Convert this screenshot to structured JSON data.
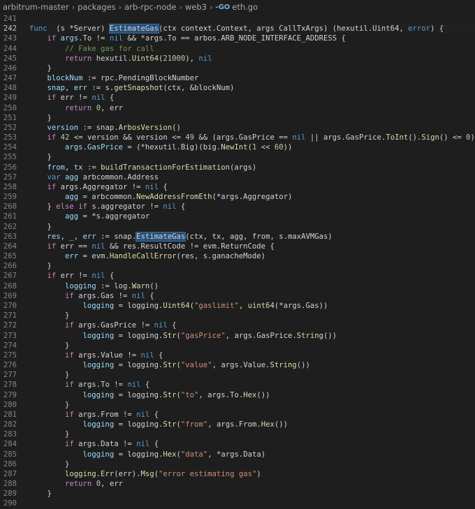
{
  "breadcrumb": [
    "arbitrum-master",
    "packages",
    "arb-rpc-node",
    "web3",
    "eth.go"
  ],
  "file_icon": "go-file-icon",
  "current_line": 242,
  "lines": [
    {
      "n": "241",
      "s": []
    },
    {
      "n": "242",
      "s": [
        [
          "kw",
          "func"
        ],
        [
          "",
          "  (s *Server) "
        ],
        [
          "hl",
          "EstimateGas"
        ],
        [
          "",
          "(ctx context.Context, args CallTxArgs) (hexutil.Uint64, "
        ],
        [
          "kw",
          "error"
        ],
        [
          "",
          ") {"
        ]
      ]
    },
    {
      "n": "243",
      "s": [
        [
          "",
          "    "
        ],
        [
          "kw2",
          "if"
        ],
        [
          "var",
          " args"
        ],
        [
          "",
          ".To != "
        ],
        [
          "kw",
          "nil"
        ],
        [
          "",
          ""
        ],
        [
          "",
          ""
        ],
        [
          "",
          ""
        ],
        [
          "",
          " && *args.To == arbos.ARB_NODE_INTERFACE_ADDRESS {"
        ]
      ]
    },
    {
      "n": "244",
      "s": [
        [
          "",
          "        "
        ],
        [
          "com",
          "// Fake gas for call"
        ]
      ]
    },
    {
      "n": "245",
      "s": [
        [
          "",
          "        "
        ],
        [
          "kw2",
          "return"
        ],
        [
          "",
          " hexutil."
        ],
        [
          "fn",
          "Uint64"
        ],
        [
          "",
          "("
        ],
        [
          "num",
          "21000"
        ],
        [
          "",
          "), "
        ],
        [
          "kw",
          "nil"
        ]
      ]
    },
    {
      "n": "246",
      "s": [
        [
          "",
          "    }"
        ]
      ]
    },
    {
      "n": "247",
      "s": [
        [
          "",
          "    "
        ],
        [
          "var",
          "blockNum"
        ],
        [
          "",
          " := rpc.PendingBlockNumber"
        ]
      ]
    },
    {
      "n": "248",
      "s": [
        [
          "",
          "    "
        ],
        [
          "var",
          "snap"
        ],
        [
          "",
          ", "
        ],
        [
          "var",
          "err"
        ],
        [
          "",
          " := s."
        ],
        [
          "fn",
          "getSnapshot"
        ],
        [
          "",
          "(ctx, &blockNum)"
        ]
      ]
    },
    {
      "n": "249",
      "s": [
        [
          "",
          "    "
        ],
        [
          "kw2",
          "if"
        ],
        [
          "",
          " err != "
        ],
        [
          "kw",
          "nil"
        ],
        [
          "",
          " {"
        ]
      ]
    },
    {
      "n": "250",
      "s": [
        [
          "",
          "        "
        ],
        [
          "kw2",
          "return"
        ],
        [
          "",
          " "
        ],
        [
          "num",
          "0"
        ],
        [
          "",
          ", err"
        ]
      ]
    },
    {
      "n": "251",
      "s": [
        [
          "",
          "    }"
        ]
      ]
    },
    {
      "n": "252",
      "s": [
        [
          "",
          "    "
        ],
        [
          "var",
          "version"
        ],
        [
          "",
          " := snap."
        ],
        [
          "fn",
          "ArbosVersion"
        ],
        [
          "",
          "()"
        ]
      ]
    },
    {
      "n": "253",
      "s": [
        [
          "",
          "    "
        ],
        [
          "kw2",
          "if"
        ],
        [
          "",
          " "
        ],
        [
          "num",
          "42"
        ],
        [
          "",
          " <= version && version <= "
        ],
        [
          "num",
          "49"
        ],
        [
          "",
          " && (args.GasPrice == "
        ],
        [
          "kw",
          "nil"
        ],
        [
          "",
          " || args.GasPrice."
        ],
        [
          "fn",
          "ToInt"
        ],
        [
          "",
          "()."
        ],
        [
          "fn",
          "Sign"
        ],
        [
          "",
          "() <= "
        ],
        [
          "num",
          "0"
        ],
        [
          "",
          ") {"
        ]
      ]
    },
    {
      "n": "254",
      "s": [
        [
          "",
          "        "
        ],
        [
          "var",
          "args"
        ],
        [
          "",
          "."
        ],
        [
          "var",
          "GasPrice"
        ],
        [
          "",
          " = (*hexutil.Big)(big."
        ],
        [
          "fn",
          "NewInt"
        ],
        [
          "",
          "("
        ],
        [
          "num",
          "1"
        ],
        [
          "",
          " << "
        ],
        [
          "num",
          "60"
        ],
        [
          "",
          "))"
        ]
      ]
    },
    {
      "n": "255",
      "s": [
        [
          "",
          "    }"
        ]
      ]
    },
    {
      "n": "256",
      "s": [
        [
          "",
          "    "
        ],
        [
          "var",
          "from"
        ],
        [
          "",
          ", "
        ],
        [
          "var",
          "tx"
        ],
        [
          "",
          " := "
        ],
        [
          "fn",
          "buildTransactionForEstimation"
        ],
        [
          "",
          "(args)"
        ]
      ]
    },
    {
      "n": "257",
      "s": [
        [
          "",
          "    "
        ],
        [
          "kw",
          "var"
        ],
        [
          "",
          " "
        ],
        [
          "var",
          "agg"
        ],
        [
          "",
          " arbcommon.Address"
        ]
      ]
    },
    {
      "n": "258",
      "s": [
        [
          "",
          "    "
        ],
        [
          "kw2",
          "if"
        ],
        [
          "",
          " args.Aggregator != "
        ],
        [
          "kw",
          "nil"
        ],
        [
          "",
          " {"
        ]
      ]
    },
    {
      "n": "259",
      "s": [
        [
          "",
          "        "
        ],
        [
          "var",
          "agg"
        ],
        [
          "",
          " = arbcommon."
        ],
        [
          "fn",
          "NewAddressFromEth"
        ],
        [
          "",
          "(*args.Aggregator)"
        ]
      ]
    },
    {
      "n": "260",
      "s": [
        [
          "",
          "    } "
        ],
        [
          "kw2",
          "else if"
        ],
        [
          "",
          " s.aggregator != "
        ],
        [
          "kw",
          "nil"
        ],
        [
          "",
          " {"
        ]
      ]
    },
    {
      "n": "261",
      "s": [
        [
          "",
          "        "
        ],
        [
          "var",
          "agg"
        ],
        [
          "",
          " = *s.aggregator"
        ]
      ]
    },
    {
      "n": "262",
      "s": [
        [
          "",
          "    }"
        ]
      ]
    },
    {
      "n": "263",
      "s": [
        [
          "",
          "    "
        ],
        [
          "var",
          "res"
        ],
        [
          "",
          ", _, "
        ],
        [
          "var",
          "err"
        ],
        [
          "",
          " := snap."
        ],
        [
          "hl",
          "EstimateGas"
        ],
        [
          "",
          "(ctx, tx, agg, from, s.maxAVMGas)"
        ]
      ]
    },
    {
      "n": "264",
      "s": [
        [
          "",
          "    "
        ],
        [
          "kw2",
          "if"
        ],
        [
          "",
          " err == "
        ],
        [
          "kw",
          "nil"
        ],
        [
          "",
          " && res.ResultCode != evm.ReturnCode {"
        ]
      ]
    },
    {
      "n": "265",
      "s": [
        [
          "",
          "        "
        ],
        [
          "var",
          "err"
        ],
        [
          "",
          " = evm."
        ],
        [
          "fn",
          "HandleCallError"
        ],
        [
          "",
          "(res, s.ganacheMode)"
        ]
      ]
    },
    {
      "n": "266",
      "s": [
        [
          "",
          "    }"
        ]
      ]
    },
    {
      "n": "267",
      "s": [
        [
          "",
          "    "
        ],
        [
          "kw2",
          "if"
        ],
        [
          "",
          " err != "
        ],
        [
          "kw",
          "nil"
        ],
        [
          "",
          " {"
        ]
      ]
    },
    {
      "n": "268",
      "s": [
        [
          "",
          "        "
        ],
        [
          "var",
          "logging"
        ],
        [
          "",
          " := log."
        ],
        [
          "fn",
          "Warn"
        ],
        [
          "",
          "()"
        ]
      ]
    },
    {
      "n": "269",
      "s": [
        [
          "",
          "        "
        ],
        [
          "kw2",
          "if"
        ],
        [
          "",
          " args.Gas != "
        ],
        [
          "kw",
          "nil"
        ],
        [
          "",
          " {"
        ]
      ]
    },
    {
      "n": "270",
      "s": [
        [
          "",
          "            "
        ],
        [
          "var",
          "logging"
        ],
        [
          "",
          " = logging."
        ],
        [
          "fn",
          "Uint64"
        ],
        [
          "",
          "("
        ],
        [
          "str",
          "\"gaslimit\""
        ],
        [
          "",
          ", "
        ],
        [
          "fn",
          "uint64"
        ],
        [
          "",
          "(*args.Gas))"
        ]
      ]
    },
    {
      "n": "271",
      "s": [
        [
          "",
          "        }"
        ]
      ]
    },
    {
      "n": "272",
      "s": [
        [
          "",
          "        "
        ],
        [
          "kw2",
          "if"
        ],
        [
          "",
          " args.GasPrice != "
        ],
        [
          "kw",
          "nil"
        ],
        [
          "",
          " {"
        ]
      ]
    },
    {
      "n": "273",
      "s": [
        [
          "",
          "            "
        ],
        [
          "var",
          "logging"
        ],
        [
          "",
          " = logging."
        ],
        [
          "fn",
          "Str"
        ],
        [
          "",
          "("
        ],
        [
          "str",
          "\"gasPrice\""
        ],
        [
          "",
          ", args.GasPrice."
        ],
        [
          "fn",
          "String"
        ],
        [
          "",
          "())"
        ]
      ]
    },
    {
      "n": "274",
      "s": [
        [
          "",
          "        }"
        ]
      ]
    },
    {
      "n": "275",
      "s": [
        [
          "",
          "        "
        ],
        [
          "kw2",
          "if"
        ],
        [
          "",
          " args.Value != "
        ],
        [
          "kw",
          "nil"
        ],
        [
          "",
          " {"
        ]
      ]
    },
    {
      "n": "276",
      "s": [
        [
          "",
          "            "
        ],
        [
          "var",
          "logging"
        ],
        [
          "",
          " = logging."
        ],
        [
          "fn",
          "Str"
        ],
        [
          "",
          "("
        ],
        [
          "str",
          "\"value\""
        ],
        [
          "",
          ", args.Value."
        ],
        [
          "fn",
          "String"
        ],
        [
          "",
          "())"
        ]
      ]
    },
    {
      "n": "277",
      "s": [
        [
          "",
          "        }"
        ]
      ]
    },
    {
      "n": "278",
      "s": [
        [
          "",
          "        "
        ],
        [
          "kw2",
          "if"
        ],
        [
          "",
          " args.To != "
        ],
        [
          "kw",
          "nil"
        ],
        [
          "",
          " {"
        ]
      ]
    },
    {
      "n": "279",
      "s": [
        [
          "",
          "            "
        ],
        [
          "var",
          "logging"
        ],
        [
          "",
          " = logging."
        ],
        [
          "fn",
          "Str"
        ],
        [
          "",
          "("
        ],
        [
          "str",
          "\"to\""
        ],
        [
          "",
          ", args.To."
        ],
        [
          "fn",
          "Hex"
        ],
        [
          "",
          "())"
        ]
      ]
    },
    {
      "n": "280",
      "s": [
        [
          "",
          "        }"
        ]
      ]
    },
    {
      "n": "281",
      "s": [
        [
          "",
          "        "
        ],
        [
          "kw2",
          "if"
        ],
        [
          "",
          " args.From != "
        ],
        [
          "kw",
          "nil"
        ],
        [
          "",
          " {"
        ]
      ]
    },
    {
      "n": "282",
      "s": [
        [
          "",
          "            "
        ],
        [
          "var",
          "logging"
        ],
        [
          "",
          " = logging."
        ],
        [
          "fn",
          "Str"
        ],
        [
          "",
          "("
        ],
        [
          "str",
          "\"from\""
        ],
        [
          "",
          ", args.From."
        ],
        [
          "fn",
          "Hex"
        ],
        [
          "",
          "())"
        ]
      ]
    },
    {
      "n": "283",
      "s": [
        [
          "",
          "        }"
        ]
      ]
    },
    {
      "n": "284",
      "s": [
        [
          "",
          "        "
        ],
        [
          "kw2",
          "if"
        ],
        [
          "",
          " args.Data != "
        ],
        [
          "kw",
          "nil"
        ],
        [
          "",
          " {"
        ]
      ]
    },
    {
      "n": "285",
      "s": [
        [
          "",
          "            "
        ],
        [
          "var",
          "logging"
        ],
        [
          "",
          " = logging."
        ],
        [
          "fn",
          "Hex"
        ],
        [
          "",
          "("
        ],
        [
          "str",
          "\"data\""
        ],
        [
          "",
          ", *args.Data)"
        ]
      ]
    },
    {
      "n": "286",
      "s": [
        [
          "",
          "        }"
        ]
      ]
    },
    {
      "n": "287",
      "s": [
        [
          "",
          "        "
        ],
        [
          "fn",
          "logging.Err"
        ],
        [
          "",
          "(err)."
        ],
        [
          "fn",
          "Msg"
        ],
        [
          "",
          "("
        ],
        [
          "str",
          "\"error estimating gas\""
        ],
        [
          "",
          ")"
        ]
      ]
    },
    {
      "n": "288",
      "s": [
        [
          "",
          "        "
        ],
        [
          "kw2",
          "return"
        ],
        [
          "",
          " "
        ],
        [
          "num",
          "0"
        ],
        [
          "",
          ", err"
        ]
      ]
    },
    {
      "n": "289",
      "s": [
        [
          "",
          "    }"
        ]
      ]
    },
    {
      "n": "290",
      "s": []
    }
  ]
}
